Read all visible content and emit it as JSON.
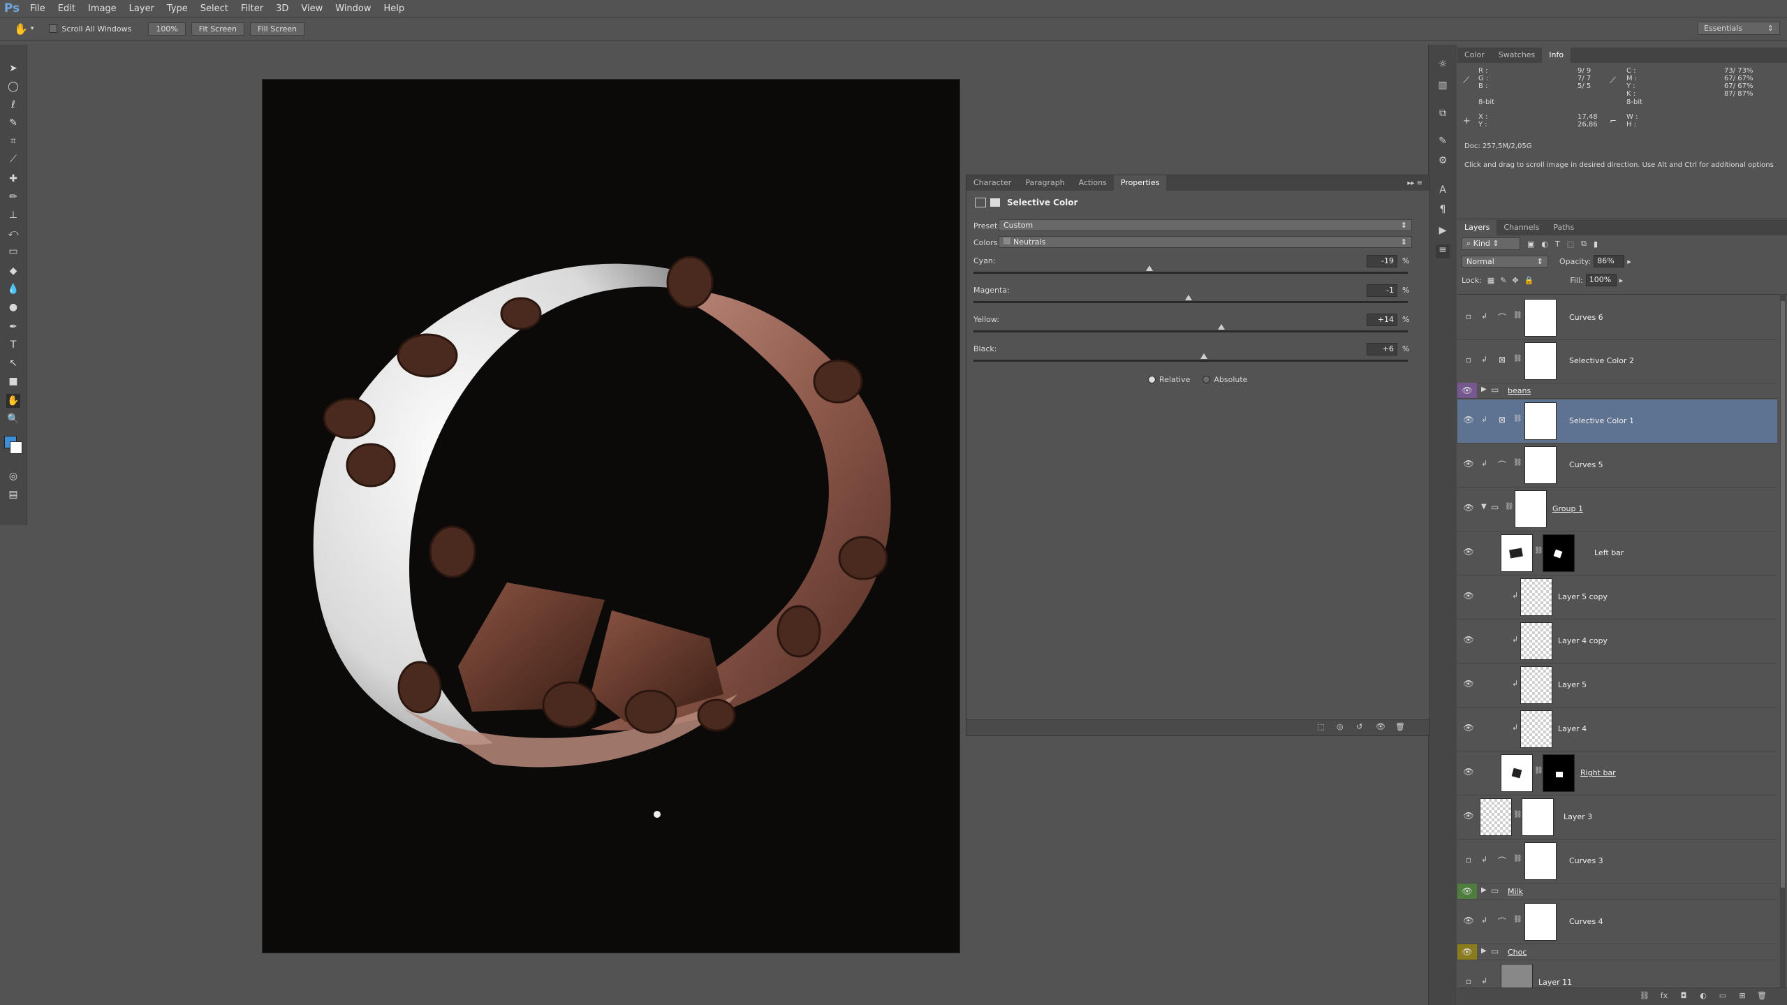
{
  "app": {
    "logo": "Ps",
    "menu": [
      "File",
      "Edit",
      "Image",
      "Layer",
      "Type",
      "Select",
      "Filter",
      "3D",
      "View",
      "Window",
      "Help"
    ]
  },
  "options_bar": {
    "scroll_all_windows": "Scroll All Windows",
    "zoom_100": "100%",
    "fit_screen": "Fit Screen",
    "fill_screen": "Fill Screen",
    "workspace": "Essentials"
  },
  "properties_panel": {
    "tabs": [
      "Character",
      "Paragraph",
      "Actions",
      "Properties"
    ],
    "active_tab": "Properties",
    "title": "Selective Color",
    "preset_label": "Preset:",
    "preset_value": "Custom",
    "colors_label": "Colors:",
    "colors_value": "Neutrals",
    "sliders": [
      {
        "label": "Cyan:",
        "value": "-19",
        "unit": "%",
        "level": -19
      },
      {
        "label": "Magenta:",
        "value": "-1",
        "unit": "%",
        "level": -1
      },
      {
        "label": "Yellow:",
        "value": "+14",
        "unit": "%",
        "level": 14
      },
      {
        "label": "Black:",
        "value": "+6",
        "unit": "%",
        "level": 6
      }
    ],
    "method_relative": "Relative",
    "method_absolute": "Absolute",
    "method_selected": "Relative"
  },
  "info_panel": {
    "tabs": [
      "Color",
      "Swatches",
      "Info"
    ],
    "active_tab": "Info",
    "rgb_labels": [
      "R :",
      "G :",
      "B :"
    ],
    "rgb_values": [
      "9/ 9",
      "7/ 7",
      "5/ 5"
    ],
    "cmyk_labels": [
      "C :",
      "M :",
      "Y :",
      "K :"
    ],
    "cmyk_values": [
      "73/ 73%",
      "67/ 67%",
      "67/ 67%",
      "87/ 87%"
    ],
    "bit_left": "8-bit",
    "bit_right": "8-bit",
    "xy_labels": [
      "X :",
      "Y :"
    ],
    "xy_values": [
      "17,48",
      "26,86"
    ],
    "wh_labels": [
      "W :",
      "H :"
    ],
    "doc": "Doc: 257,5M/2,05G",
    "hint": "Click and drag to scroll image in desired direction.  Use Alt and Ctrl for additional options"
  },
  "layers_panel": {
    "tabs": [
      "Layers",
      "Channels",
      "Paths"
    ],
    "active_tab": "Layers",
    "filter": "Kind",
    "blend_mode": "Normal",
    "opacity_label": "Opacity:",
    "opacity": "86%",
    "lock_label": "Lock:",
    "fill_label": "Fill:",
    "fill": "100%",
    "layers": [
      {
        "name": "Curves 6",
        "kind": "adjustment",
        "visible": false
      },
      {
        "name": "Selective Color 2",
        "kind": "adjustment",
        "visible": false
      },
      {
        "name": "beans",
        "kind": "group",
        "visible": true,
        "color": "#77578f"
      },
      {
        "name": "Selective Color 1",
        "kind": "adjustment",
        "visible": true,
        "selected": true
      },
      {
        "name": "Curves 5",
        "kind": "adjustment",
        "visible": true
      },
      {
        "name": "Group 1",
        "kind": "group-open",
        "visible": true
      },
      {
        "name": "Left bar",
        "kind": "masked",
        "visible": true
      },
      {
        "name": "Layer 5 copy",
        "kind": "pixel",
        "visible": true
      },
      {
        "name": "Layer 4 copy",
        "kind": "pixel",
        "visible": true
      },
      {
        "name": "Layer 5",
        "kind": "pixel",
        "visible": true
      },
      {
        "name": "Layer 4",
        "kind": "pixel",
        "visible": true
      },
      {
        "name": "Right bar",
        "kind": "masked",
        "visible": true
      },
      {
        "name": "Layer 3",
        "kind": "masked-pixel",
        "visible": true
      },
      {
        "name": "Curves 3",
        "kind": "adjustment",
        "visible": false
      },
      {
        "name": "Milk",
        "kind": "group",
        "visible": true,
        "color": "#4e7d3e"
      },
      {
        "name": "Curves 4",
        "kind": "adjustment",
        "visible": true
      },
      {
        "name": "Choc",
        "kind": "group",
        "visible": true,
        "color": "#8a7b1f"
      },
      {
        "name": "Layer 11",
        "kind": "pixel",
        "visible": false
      }
    ]
  },
  "colors": {
    "ui_bg": "#535353",
    "canvas_bg": "#0c0909",
    "selected_layer": "#5e7392",
    "foreground_swatch": "#3d8fd6",
    "background_swatch": "#ffffff"
  }
}
